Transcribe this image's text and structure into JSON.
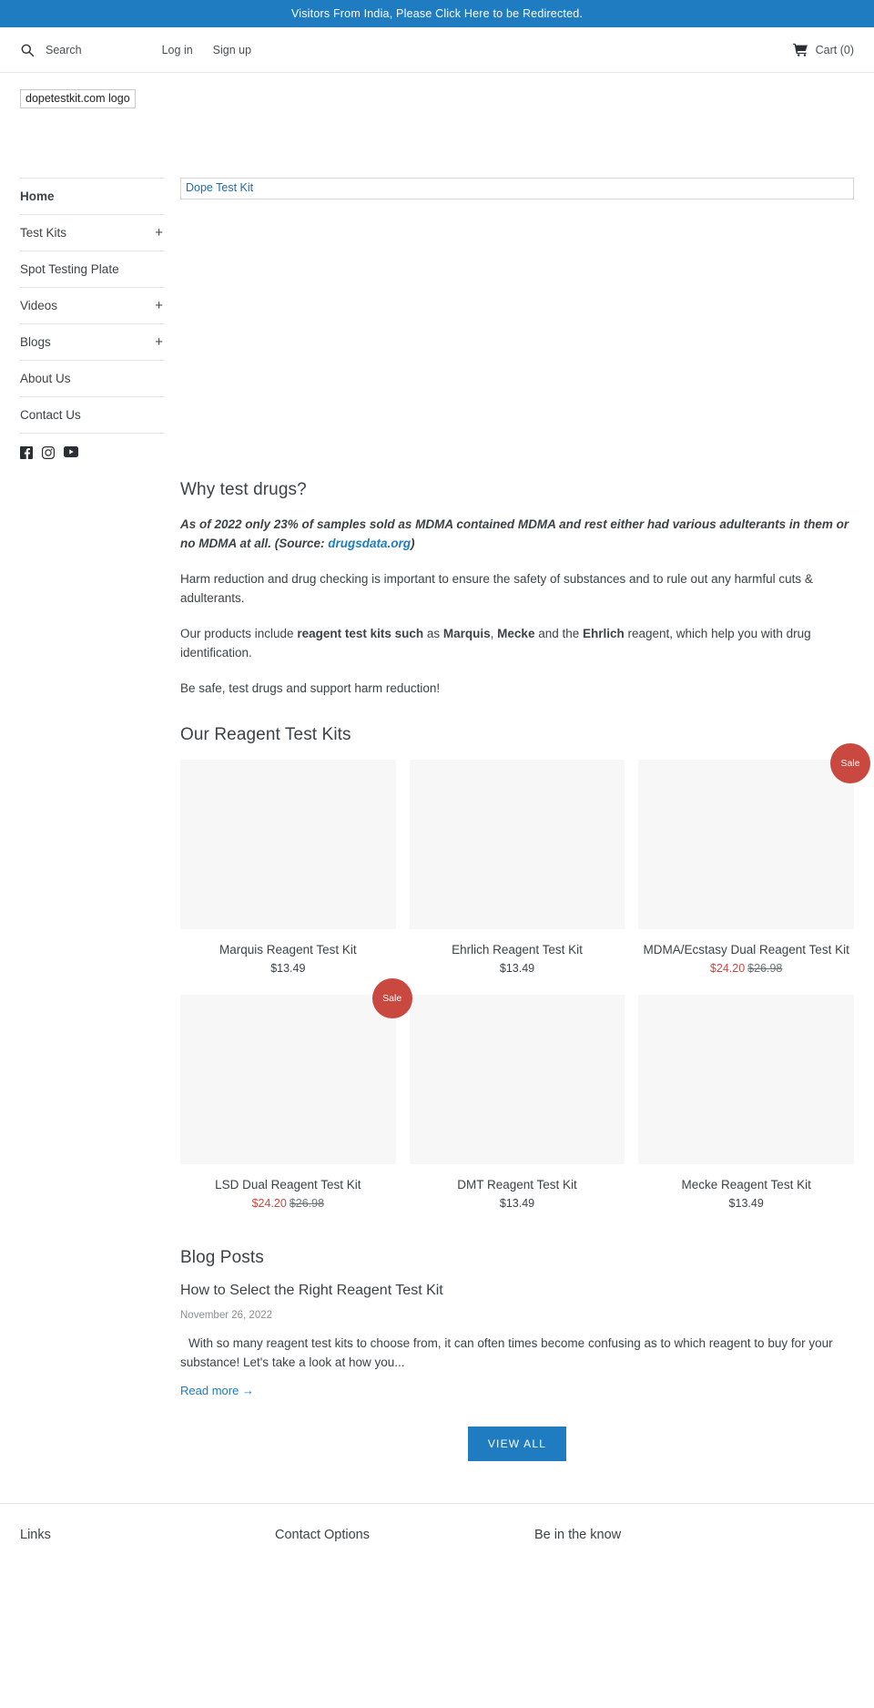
{
  "announcement": {
    "text": "Visitors From India, Please Click Here to be Redirected."
  },
  "topbar": {
    "search_label": "Search",
    "login_label": "Log in",
    "signup_label": "Sign up",
    "cart_label": "Cart (0)"
  },
  "logo": {
    "alt_text": "dopetestkit.com logo"
  },
  "hero": {
    "alt_text": "Dope Test Kit"
  },
  "sidebar": {
    "items": [
      {
        "label": "Home",
        "expandable": false,
        "active": true
      },
      {
        "label": "Test Kits",
        "expandable": true,
        "active": false
      },
      {
        "label": "Spot Testing Plate",
        "expandable": false,
        "active": false
      },
      {
        "label": "Videos",
        "expandable": true,
        "active": false
      },
      {
        "label": "Blogs",
        "expandable": true,
        "active": false
      },
      {
        "label": "About Us",
        "expandable": false,
        "active": false
      },
      {
        "label": "Contact Us",
        "expandable": false,
        "active": false
      }
    ],
    "expand_symbol": "+",
    "social": [
      {
        "name": "facebook"
      },
      {
        "name": "instagram"
      },
      {
        "name": "youtube"
      }
    ]
  },
  "why_section": {
    "heading": "Why test drugs?",
    "lead_before": "As of 2022 only 23% of samples sold as MDMA contained MDMA and rest either had various adulterants in them or no MDMA at all. (Source: ",
    "lead_link": "drugsdata.org",
    "lead_after": ")",
    "paragraph2": "Harm reduction and drug checking is important to ensure the safety of substances and to rule out any harmful cuts & adulterants.",
    "p3_a": "Our products include ",
    "p3_b": "reagent test kits such",
    "p3_c": " as ",
    "p3_d": "Marquis",
    "p3_e": ", ",
    "p3_f": "Mecke",
    "p3_g": " and the ",
    "p3_h": "Ehrlich",
    "p3_i": " reagent, which help you with drug identification.",
    "paragraph4": "Be safe, test drugs and support harm reduction!"
  },
  "products_section": {
    "heading": "Our Reagent Test Kits",
    "sale_badge_label": "Sale",
    "items": [
      {
        "title": "Marquis Reagent Test Kit",
        "price": "$13.49",
        "compare_at": "",
        "on_sale": false
      },
      {
        "title": "Ehrlich Reagent Test Kit",
        "price": "$13.49",
        "compare_at": "",
        "on_sale": false
      },
      {
        "title": "MDMA/Ecstasy Dual Reagent Test Kit",
        "price": "$24.20",
        "compare_at": "$26.98",
        "on_sale": true
      },
      {
        "title": "LSD Dual Reagent Test Kit",
        "price": "$24.20",
        "compare_at": "$26.98",
        "on_sale": true
      },
      {
        "title": "DMT Reagent Test Kit",
        "price": "$13.49",
        "compare_at": "",
        "on_sale": false
      },
      {
        "title": "Mecke Reagent Test Kit",
        "price": "$13.49",
        "compare_at": "",
        "on_sale": false
      }
    ]
  },
  "blog_section": {
    "heading": "Blog Posts",
    "post_title": "How to Select the Right Reagent Test Kit",
    "post_date": "November 26, 2022",
    "post_excerpt": "With so many reagent test kits to choose from, it can often times become confusing as to which reagent to buy for your substance! Let's take a look at how you...",
    "read_more": "Read more →",
    "view_all": "VIEW ALL"
  },
  "footer": {
    "col1_heading": "Links",
    "col2_heading": "Contact Options",
    "col3_heading": "Be in the know"
  },
  "colors": {
    "brand_blue": "#1f7cc0",
    "sale_red": "#c9483f",
    "text": "#3d4246"
  }
}
